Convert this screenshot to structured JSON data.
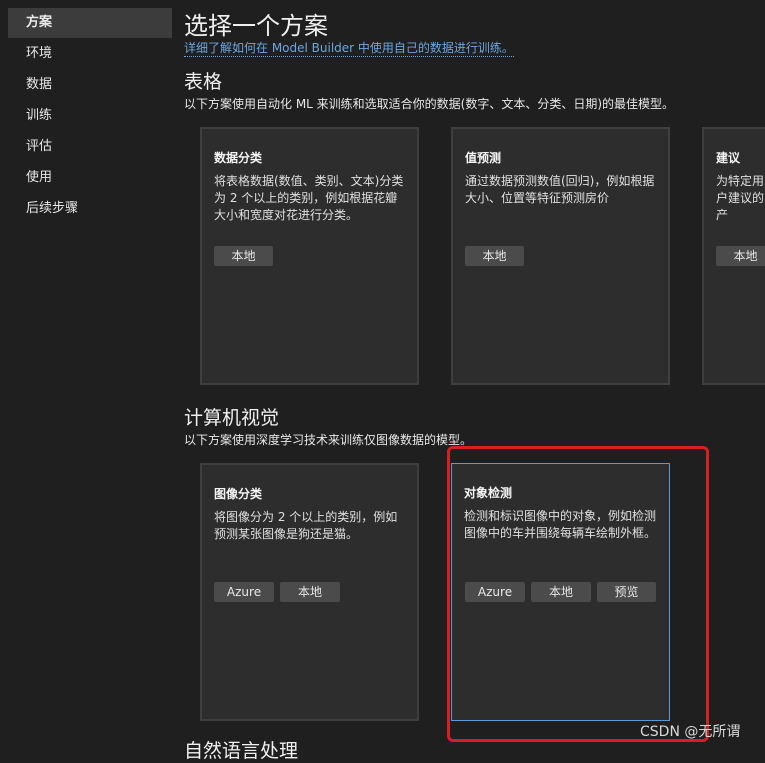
{
  "sidebar": {
    "items": [
      {
        "label": "方案"
      },
      {
        "label": "环境"
      },
      {
        "label": "数据"
      },
      {
        "label": "训练"
      },
      {
        "label": "评估"
      },
      {
        "label": "使用"
      },
      {
        "label": "后续步骤"
      }
    ]
  },
  "main": {
    "title": "选择一个方案",
    "link": "详细了解如何在 Model Builder 中使用自己的数据进行训练。",
    "sections": [
      {
        "title": "表格",
        "desc": "以下方案使用自动化 ML 来训练和选取适合你的数据(数字、文本、分类、日期)的最佳模型。",
        "cards": [
          {
            "title": "数据分类",
            "desc": "将表格数据(数值、类别、文本)分类为 2 个以上的类别，例如根据花瓣大小和宽度对花进行分类。",
            "buttons": [
              "本地"
            ]
          },
          {
            "title": "值预测",
            "desc": "通过数据预测数值(回归)，例如根据大小、位置等特征预测房价",
            "buttons": [
              "本地"
            ]
          },
          {
            "title": "建议",
            "desc": "为特定用户建议的产",
            "buttons": [
              "本地"
            ]
          }
        ]
      },
      {
        "title": "计算机视觉",
        "desc": "以下方案使用深度学习技术来训练仅图像数据的模型。",
        "cards": [
          {
            "title": "图像分类",
            "desc": "将图像分为 2 个以上的类别，例如预测某张图像是狗还是猫。",
            "buttons": [
              "Azure",
              "本地"
            ]
          },
          {
            "title": "对象检测",
            "desc": "检测和标识图像中的对象，例如检测图像中的车并围绕每辆车绘制外框。",
            "buttons": [
              "Azure",
              "本地",
              "预览"
            ]
          }
        ]
      }
    ],
    "next_section_title": "自然语言处理"
  },
  "watermark": "CSDN @无所谓"
}
